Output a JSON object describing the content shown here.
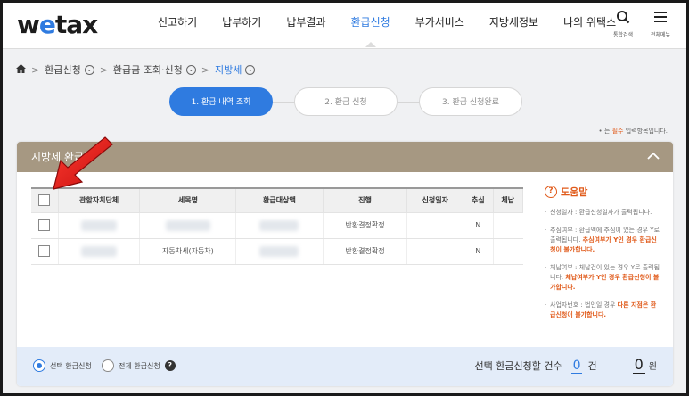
{
  "header": {
    "logo_pre": "w",
    "logo_e": "e",
    "logo_post": "tax",
    "nav": [
      "신고하기",
      "납부하기",
      "납부결과",
      "환급신청",
      "부가서비스",
      "지방세정보",
      "나의 위택스"
    ],
    "search_label": "통합검색",
    "menu_label": "전체메뉴"
  },
  "breadcrumb": {
    "items": [
      "환급신청",
      "환급금 조회·신청",
      "지방세"
    ]
  },
  "steps": [
    "1. 환급 내역 조회",
    "2. 환급 신청",
    "3. 환급 신청완료"
  ],
  "required_note": {
    "prefix": "• 는 ",
    "star": "필수",
    "suffix": " 입력항목입니다."
  },
  "panel": {
    "title": "지방세 환급금",
    "table": {
      "headers": [
        "",
        "관할자치단체",
        "세목명",
        "환급대상액",
        "진행",
        "신청일자",
        "추심",
        "체납"
      ],
      "rows": [
        {
          "tax_name": "",
          "status": "반환결정확정",
          "date": "",
          "collection": "N",
          "arrears": ""
        },
        {
          "tax_name": "자동차세(자동차)",
          "status": "반환결정확정",
          "date": "",
          "collection": "N",
          "arrears": ""
        }
      ]
    },
    "help": {
      "title": "도움말",
      "items": [
        {
          "text": "신청일자 : 환급신청일자가 출력됩니다.",
          "warn": ""
        },
        {
          "text": "추심여부 : 환급액에 추심이 있는 경우 Y로 출력됩니다. ",
          "warn": "추심여부가 Y인 경우 환급신청이 불가합니다."
        },
        {
          "text": "체납여부 : 체납건이 있는 경우 Y로 출력됩니다. ",
          "warn": "체납여부가 Y인 경우 환급신청이 불가합니다."
        },
        {
          "text": "사업자번호 : 법인일 경우 ",
          "warn": "다른 지점은 환급신청이 불가합니다."
        }
      ]
    },
    "footer": {
      "radio_selected": "선택 환급신청",
      "radio_all": "전체 환급신청",
      "summary_label": "선택 환급신청할 건수",
      "count": "0",
      "count_unit": "건",
      "amount": "0",
      "amount_unit": "원"
    }
  },
  "colors": {
    "accent": "#2f7be0",
    "panel_header": "#a69882",
    "warning": "#e05a1a",
    "annotation": "#e01818"
  }
}
